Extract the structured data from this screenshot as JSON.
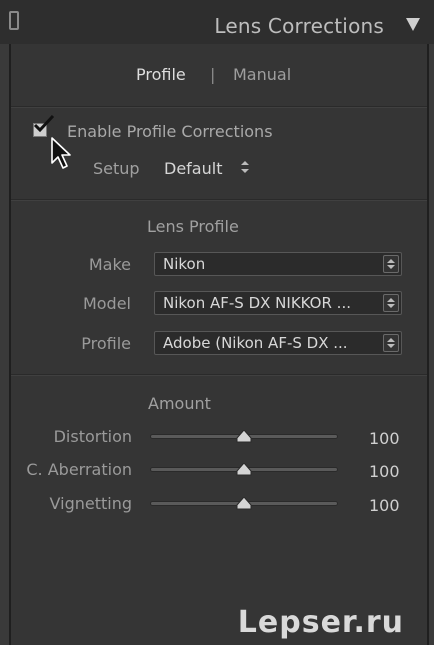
{
  "header": {
    "title": "Lens Corrections",
    "collapse_icon": "collapse-square-icon",
    "toggle_icon": "triangle-down-icon"
  },
  "tabs": [
    {
      "label": "Profile",
      "active": true
    },
    {
      "label": "Manual",
      "active": false
    }
  ],
  "tab_separator": "|",
  "enable": {
    "label": "Enable Profile Corrections",
    "checked": true
  },
  "setup": {
    "label": "Setup",
    "value": "Default"
  },
  "lens_profile": {
    "title": "Lens Profile",
    "rows": [
      {
        "label": "Make",
        "value": "Nikon"
      },
      {
        "label": "Model",
        "value": "Nikon AF-S DX NIKKOR ..."
      },
      {
        "label": "Profile",
        "value": "Adobe (Nikon AF-S DX ..."
      }
    ]
  },
  "amount": {
    "title": "Amount",
    "sliders": [
      {
        "label": "Distortion",
        "value": "100",
        "fraction": 0.5
      },
      {
        "label": "C. Aberration",
        "value": "100",
        "fraction": 0.5
      },
      {
        "label": "Vignetting",
        "value": "100",
        "fraction": 0.5
      }
    ]
  },
  "watermark": "Lepser.ru",
  "colors": {
    "background": "#3a3a3a",
    "panel": "#353535",
    "header": "#2e2e2e",
    "select_bg": "#2b2b2b"
  }
}
